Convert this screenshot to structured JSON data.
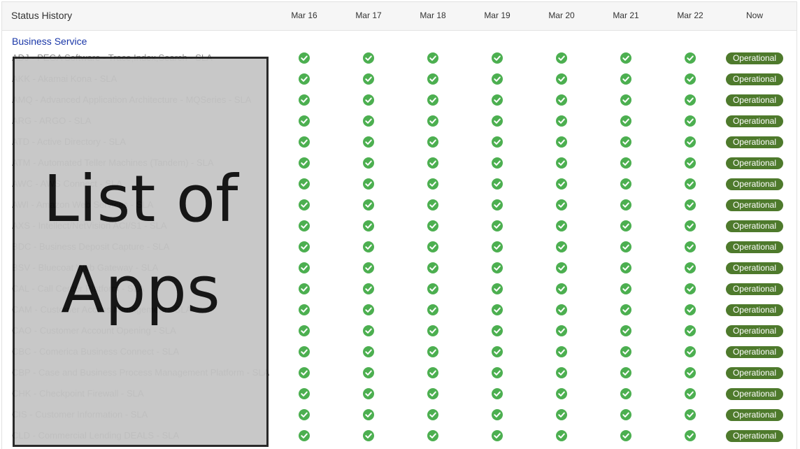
{
  "header": {
    "title": "Status History",
    "columns": [
      "Mar 16",
      "Mar 17",
      "Mar 18",
      "Mar 19",
      "Mar 20",
      "Mar 21",
      "Mar 22",
      "Now"
    ]
  },
  "group": {
    "label": "Business Service"
  },
  "rows": [
    {
      "name": "ADJ - PEGA Software - Trace,Index,Search - SLA",
      "status": "Operational"
    },
    {
      "name": "AKK - Akamai Kona - SLA",
      "status": "Operational"
    },
    {
      "name": "AMQ - Advanced Application Architecture - MQSeries - SLA",
      "status": "Operational"
    },
    {
      "name": "ARG - ARGO - SLA",
      "status": "Operational"
    },
    {
      "name": "ATD - Active Directory - SLA",
      "status": "Operational"
    },
    {
      "name": "ATM - Automated Teller Machines (Tandem) - SLA",
      "status": "Operational"
    },
    {
      "name": "AWC - AWS Connect - SLA",
      "status": "Operational"
    },
    {
      "name": "AWI - Amazon Web Services - SLA",
      "status": "Operational"
    },
    {
      "name": "AXS - Intellect/NetVision ACI/S1 - SLA",
      "status": "Operational"
    },
    {
      "name": "BDC - Business Deposit Capture - SLA",
      "status": "Operational"
    },
    {
      "name": "BSV - Bluecoat Web Gateway - SLA",
      "status": "Operational"
    },
    {
      "name": "CAL - Call Center Platform - SLA",
      "status": "Operational"
    },
    {
      "name": "CAM - Customer Access Management - SLA",
      "status": "Operational"
    },
    {
      "name": "CAO - Customer Account Opening - SLA",
      "status": "Operational"
    },
    {
      "name": "CBC - Comerica Business Connect - SLA",
      "status": "Operational"
    },
    {
      "name": "CBP - Case and Business Process Management Platform - SLA",
      "status": "Operational"
    },
    {
      "name": "CHK - Checkpoint Firewall - SLA",
      "status": "Operational"
    },
    {
      "name": "CIS - Customer Information - SLA",
      "status": "Operational"
    },
    {
      "name": "CLD - Commercial Lending DEALS - SLA",
      "status": "Operational"
    }
  ],
  "overlay": {
    "line1": "List of",
    "line2": "Apps"
  },
  "colors": {
    "check": "#4caf50",
    "badge": "#4e7a2c",
    "link": "#1a37a8",
    "overlay": "#c4c4c4"
  },
  "icons": {
    "day_status": "check-circle-icon"
  }
}
